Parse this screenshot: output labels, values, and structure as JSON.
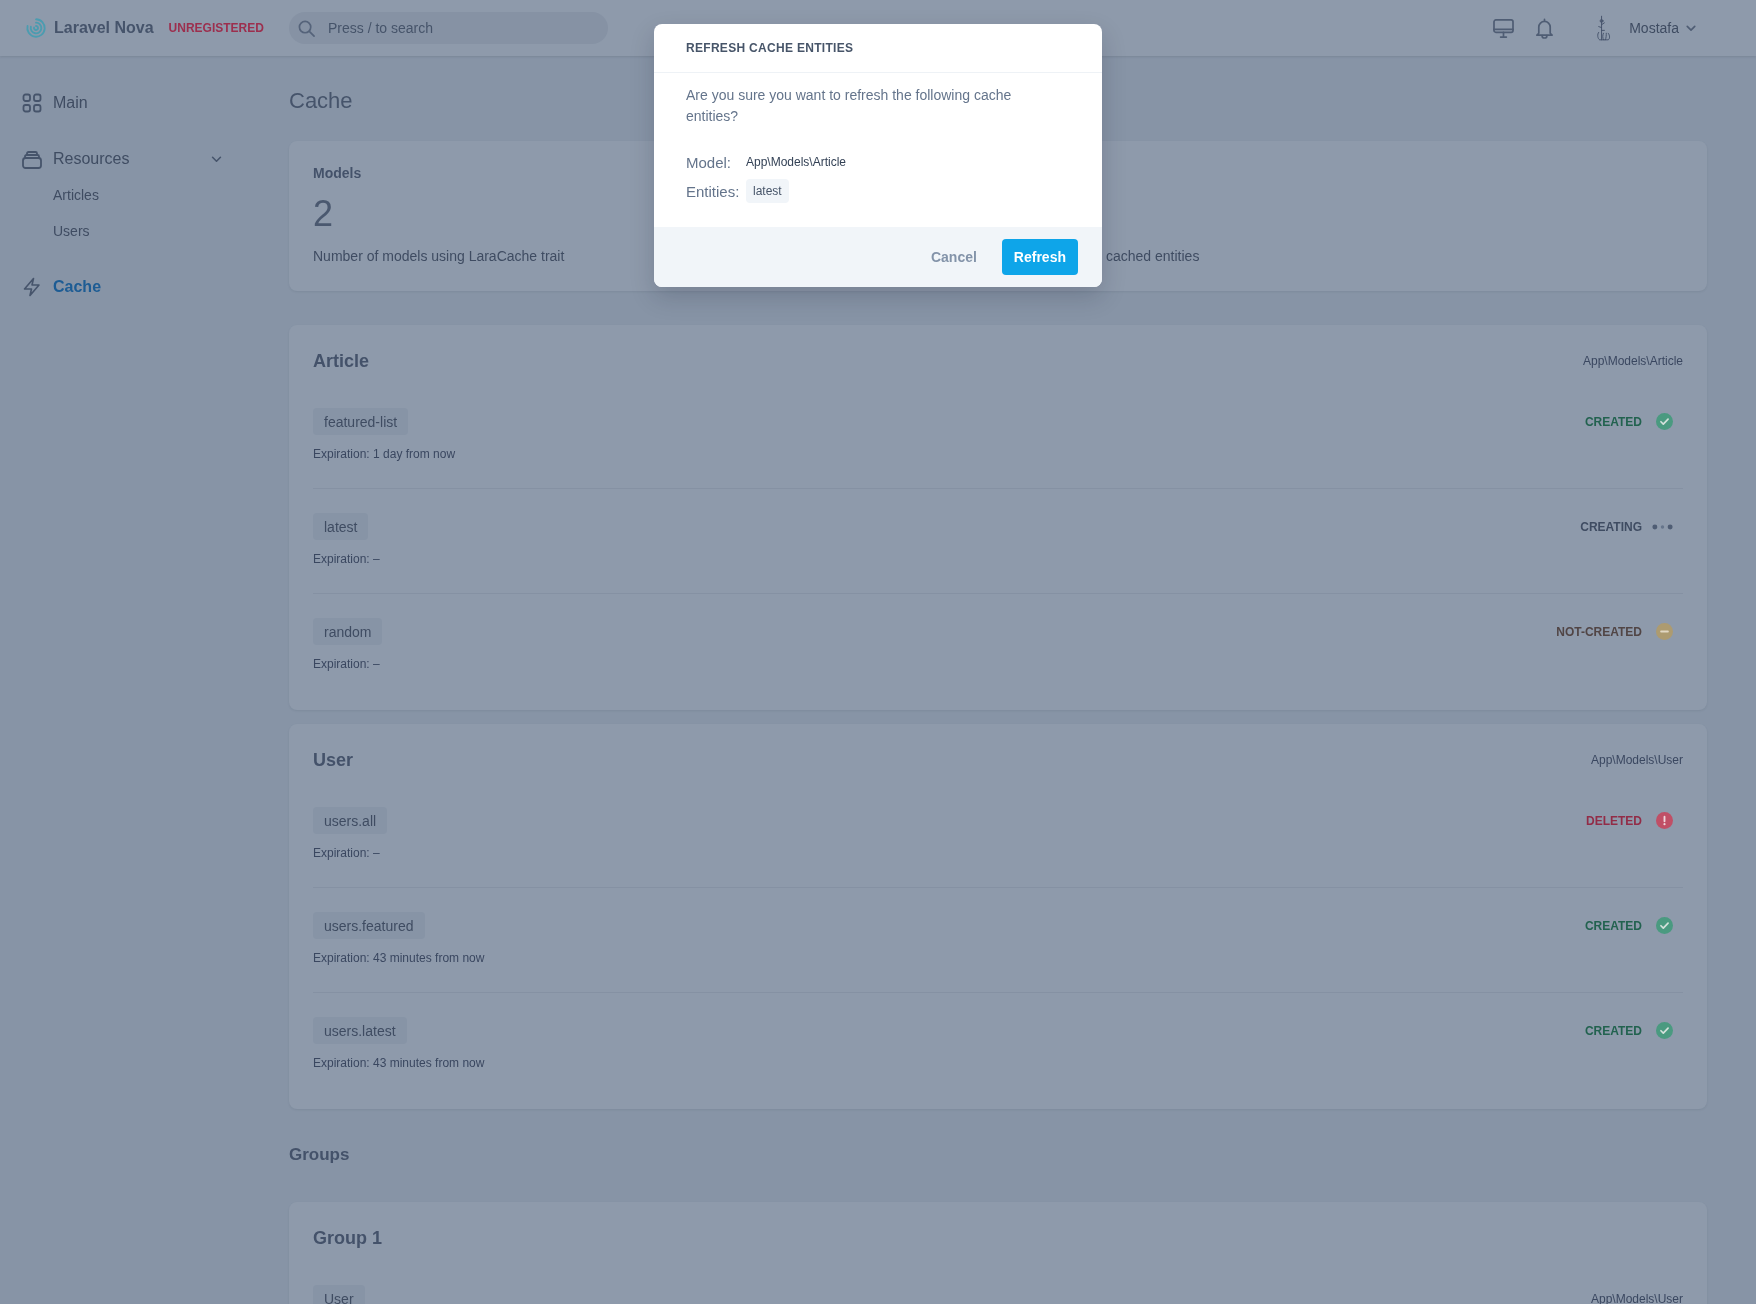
{
  "topbar": {
    "brand": "Laravel Nova",
    "badge": "UNREGISTERED",
    "search": {
      "placeholder": "Press / to search"
    },
    "user": {
      "name": "Mostafa"
    }
  },
  "sidebar": {
    "items": [
      {
        "label": "Main",
        "kind": "link",
        "selected": false
      },
      {
        "label": "Resources",
        "kind": "group",
        "selected": false,
        "expanded": true,
        "children": [
          {
            "label": "Articles",
            "selected": false
          },
          {
            "label": "Users",
            "selected": false
          }
        ]
      },
      {
        "label": "Cache",
        "kind": "link",
        "selected": true
      }
    ]
  },
  "page": {
    "title": "Cache"
  },
  "metrics": [
    {
      "title": "Models",
      "value": "2",
      "description": "Number of models using LaraCache trait"
    },
    {
      "description": "cached entities"
    }
  ],
  "models": [
    {
      "name": "Article",
      "class": "App\\Models\\Article",
      "entities": [
        {
          "name": "featured-list",
          "expiration": "Expiration: 1 day from now",
          "status": {
            "label": "CREATED",
            "kind": "created"
          }
        },
        {
          "name": "latest",
          "expiration": "Expiration: –",
          "status": {
            "label": "CREATING",
            "kind": "creating"
          }
        },
        {
          "name": "random",
          "expiration": "Expiration: –",
          "status": {
            "label": "NOT-CREATED",
            "kind": "not-created"
          }
        }
      ]
    },
    {
      "name": "User",
      "class": "App\\Models\\User",
      "entities": [
        {
          "name": "users.all",
          "expiration": "Expiration: –",
          "status": {
            "label": "DELETED",
            "kind": "deleted"
          }
        },
        {
          "name": "users.featured",
          "expiration": "Expiration: 43 minutes from now",
          "status": {
            "label": "CREATED",
            "kind": "created"
          }
        },
        {
          "name": "users.latest",
          "expiration": "Expiration: 43 minutes from now",
          "status": {
            "label": "CREATED",
            "kind": "created"
          }
        }
      ]
    }
  ],
  "groups_section": {
    "title": "Groups",
    "groups": [
      {
        "name": "Group 1",
        "items": [
          {
            "tag": "User",
            "class": "App\\Models\\User"
          }
        ]
      }
    ]
  },
  "modal": {
    "title": "REFRESH CACHE ENTITIES",
    "message": "Are you sure you want to refresh the following cache entities?",
    "fields": [
      {
        "label": "Model:",
        "kind": "text",
        "value": "App\\Models\\Article"
      },
      {
        "label": "Entities:",
        "kind": "tags",
        "tags": [
          "latest"
        ]
      }
    ],
    "buttons": [
      {
        "label": "Cancel",
        "kind": "secondary"
      },
      {
        "label": "Refresh",
        "kind": "primary"
      }
    ]
  }
}
